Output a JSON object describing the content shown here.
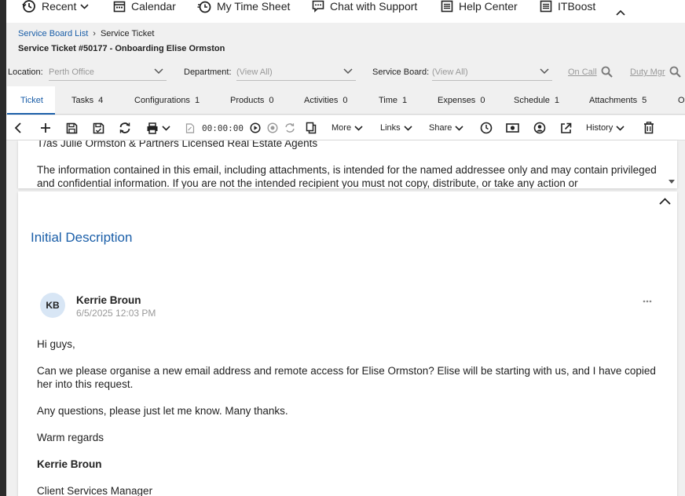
{
  "topnav": {
    "recent": "Recent",
    "calendar": "Calendar",
    "time_sheet": "My Time Sheet",
    "support": "Chat with Support",
    "help": "Help Center",
    "itboost": "ITBoost"
  },
  "breadcrumb": {
    "parent": "Service Board List",
    "current": "Service Ticket"
  },
  "page_title": "Service Ticket #50177 - Onboarding Elise Ormston",
  "filters": {
    "location_label": "Location:",
    "location_value": "Perth Office",
    "department_label": "Department:",
    "department_value": "(View All)",
    "board_label": "Service Board:",
    "board_value": "(View All)",
    "on_call": "On Call",
    "duty_mgr": "Duty Mgr"
  },
  "tabs": [
    {
      "label": "Ticket",
      "count": ""
    },
    {
      "label": "Tasks",
      "count": "4"
    },
    {
      "label": "Configurations",
      "count": "1"
    },
    {
      "label": "Products",
      "count": "0"
    },
    {
      "label": "Activities",
      "count": "0"
    },
    {
      "label": "Time",
      "count": "1"
    },
    {
      "label": "Expenses",
      "count": "0"
    },
    {
      "label": "Schedule",
      "count": "1"
    },
    {
      "label": "Attachments",
      "count": "5"
    },
    {
      "label": "O",
      "count": ""
    }
  ],
  "toolbar": {
    "timer": "00:00:00",
    "more": "More",
    "links": "Links",
    "share": "Share",
    "history": "History"
  },
  "email_snippet": {
    "line1": "T/as Julie Ormston & Partners Licensed Real Estate Agents",
    "line2": "The information contained in this email, including attachments, is intended for the named addressee only and may contain privileged and confidential information. If you are not the intended recipient you must not copy, distribute, or take any action or"
  },
  "description": {
    "title": "Initial Description",
    "author_initials": "KB",
    "author": "Kerrie Broun",
    "date": "6/5/2025 12:03 PM",
    "greeting": "Hi guys,",
    "para1": "Can we please organise a new email address and remote access for Elise Ormston? Elise will be starting with us, and I have copied her into this request.",
    "para2": "Any questions, please just let me know. Many thanks.",
    "closing": "Warm regards",
    "sign_name": "Kerrie Broun",
    "sign_role": "Client Services Manager"
  },
  "colors": {
    "accent": "#1a5ea8",
    "avatar_bg": "#d8e6f5",
    "left_bar": "#2b2b2b"
  }
}
